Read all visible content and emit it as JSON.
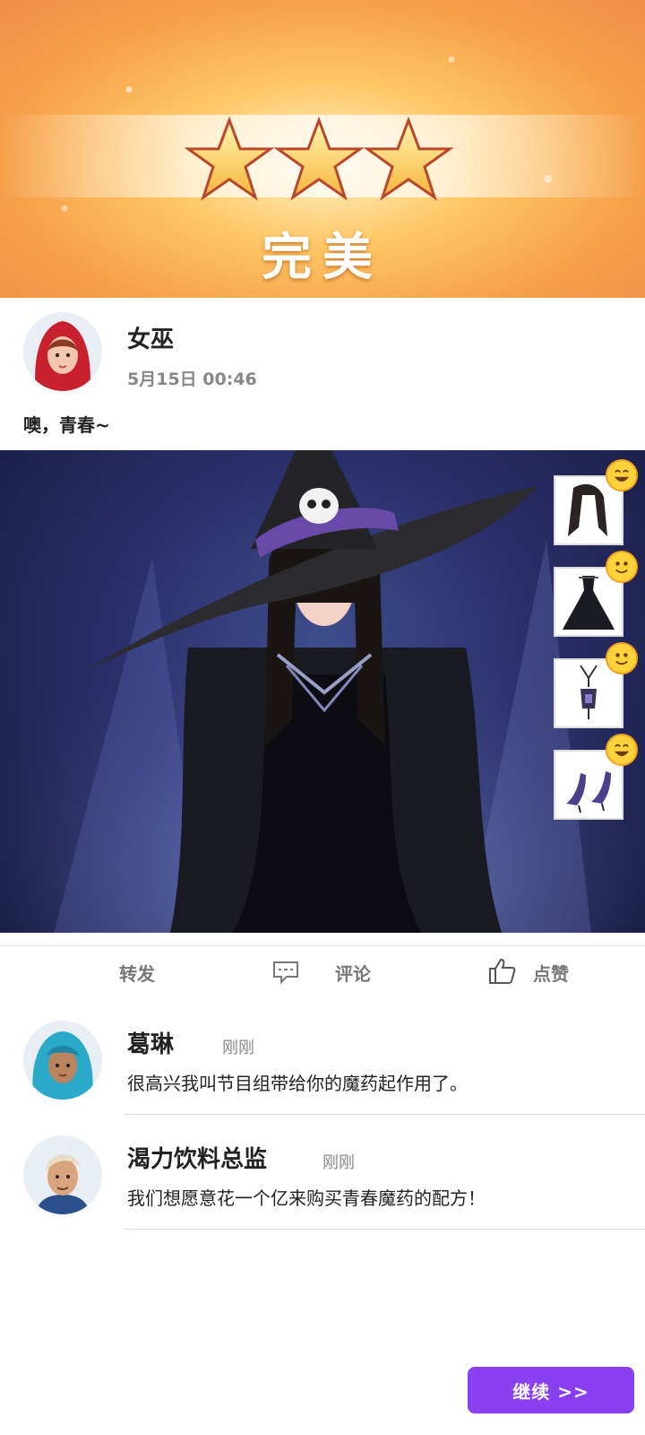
{
  "result": {
    "stars": 3,
    "label": "完美"
  },
  "post": {
    "author": "女巫",
    "time": "5月15日 00:46",
    "text": "噢，青春~"
  },
  "outfit_items": [
    {
      "icon": "hair-item-icon",
      "reaction": "grin-emoji-icon"
    },
    {
      "icon": "dress-item-icon",
      "reaction": "smile-emoji-icon"
    },
    {
      "icon": "lantern-accessory-icon",
      "reaction": "smile-emoji-icon"
    },
    {
      "icon": "shoes-item-icon",
      "reaction": "grin-emoji-icon"
    }
  ],
  "actions": {
    "repost": "转发",
    "comment": "评论",
    "like": "点赞"
  },
  "comments": [
    {
      "name": "葛琳",
      "time": "刚刚",
      "text": "很高兴我叫节目组带给你的魔药起作用了。"
    },
    {
      "name": "渴力饮料总监",
      "time": "刚刚",
      "text": "我们想愿意花一个亿来购买青春魔药的配方！"
    }
  ],
  "continue_label": "继续 >>",
  "colors": {
    "accent": "#8a3ff0",
    "banner": "#f6a04a"
  }
}
